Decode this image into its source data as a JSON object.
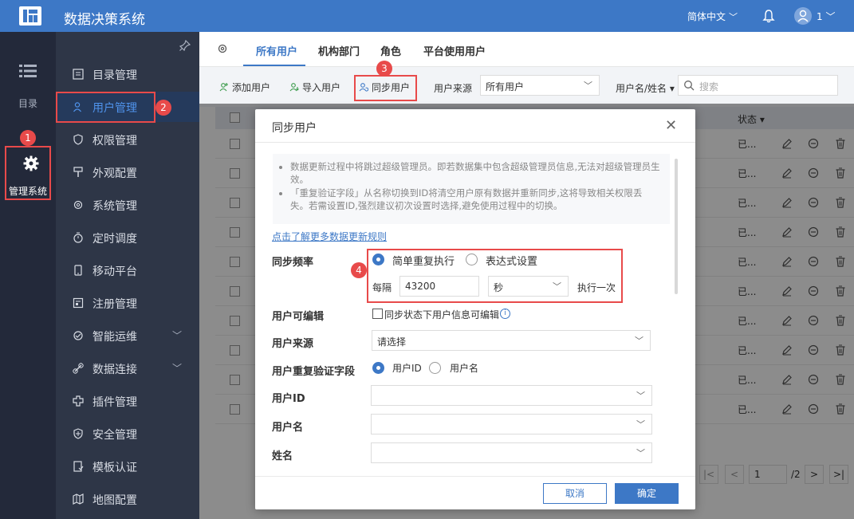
{
  "app": {
    "title": "数据决策系统",
    "language": "简体中文",
    "user": "1"
  },
  "rail": {
    "catalog_label": "目录",
    "mgmt_label": "管理系统"
  },
  "sidebar": {
    "items": [
      {
        "label": "目录管理"
      },
      {
        "label": "用户管理",
        "active": true
      },
      {
        "label": "权限管理"
      },
      {
        "label": "外观配置"
      },
      {
        "label": "系统管理"
      },
      {
        "label": "定时调度"
      },
      {
        "label": "移动平台"
      },
      {
        "label": "注册管理"
      },
      {
        "label": "智能运维",
        "expandable": true
      },
      {
        "label": "数据连接",
        "expandable": true
      },
      {
        "label": "插件管理"
      },
      {
        "label": "安全管理"
      },
      {
        "label": "模板认证"
      },
      {
        "label": "地图配置"
      }
    ]
  },
  "tabs": [
    "所有用户",
    "机构部门",
    "角色",
    "平台使用用户"
  ],
  "toolbar": {
    "add_user": "添加用户",
    "import_user": "导入用户",
    "sync_user": "同步用户",
    "source_label": "用户来源",
    "source_value": "所有用户",
    "name_filter": "用户名/姓名",
    "search_placeholder": "搜索"
  },
  "table": {
    "status_header": "状态",
    "rows": [
      "已...",
      "已...",
      "已...",
      "已...",
      "已...",
      "已...",
      "已...",
      "已...",
      "已...",
      "已..."
    ]
  },
  "pager": {
    "page": "1",
    "total": "/2"
  },
  "badges": {
    "one": "1",
    "two": "2",
    "three": "3",
    "four": "4"
  },
  "dialog": {
    "title": "同步用户",
    "notes": [
      "数据更新过程中将跳过超级管理员。即若数据集中包含超级管理员信息,无法对超级管理员生效。",
      "「重复验证字段」从名称切换到ID将清空用户原有数据并重新同步,这将导致相关权限丢失。若需设置ID,强烈建议初次设置时选择,避免使用过程中的切换。"
    ],
    "learn_more": "点击了解更多数据更新规则",
    "freq_label": "同步频率",
    "freq_simple": "简单重复执行",
    "freq_expr": "表达式设置",
    "every": "每隔",
    "interval": "43200",
    "unit": "秒",
    "exec_once": "执行一次",
    "editable_label": "用户可编辑",
    "editable_text": "同步状态下用户信息可编辑",
    "source_label": "用户来源",
    "source_placeholder": "请选择",
    "dup_label": "用户重复验证字段",
    "dup_id": "用户ID",
    "dup_name": "用户名",
    "userid_label": "用户ID",
    "username_label": "用户名",
    "realname_label": "姓名",
    "cancel": "取消",
    "ok": "确定"
  },
  "colors": {
    "brand": "#3d78c6",
    "highlight": "#e84a4a",
    "sidebar": "#2e3647",
    "rail": "#23293a"
  }
}
